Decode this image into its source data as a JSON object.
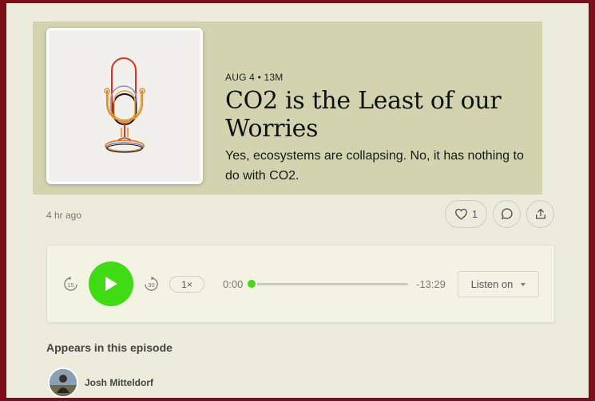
{
  "episode": {
    "date": "AUG 4",
    "separator": "•",
    "duration": "13M",
    "title": "CO2 is the Least of our Worries",
    "subtitle": "Yes, ecosystems are collapsing. No, it has nothing to do with CO2.",
    "posted": "4 hr ago"
  },
  "actions": {
    "like_count": "1"
  },
  "player": {
    "skip_back": "15",
    "skip_forward": "30",
    "speed": "1×",
    "current_time": "0:00",
    "remaining_time": "-13:29",
    "progress": 0,
    "listen_label": "Listen on"
  },
  "appears": {
    "heading": "Appears in this episode",
    "people": [
      {
        "name": "Josh Mitteldorf"
      }
    ]
  },
  "colors": {
    "accent": "#3fdb13",
    "hero_bg": "#d3d3b0",
    "page_bg": "#ecebdc",
    "frame": "#7d0d16"
  }
}
